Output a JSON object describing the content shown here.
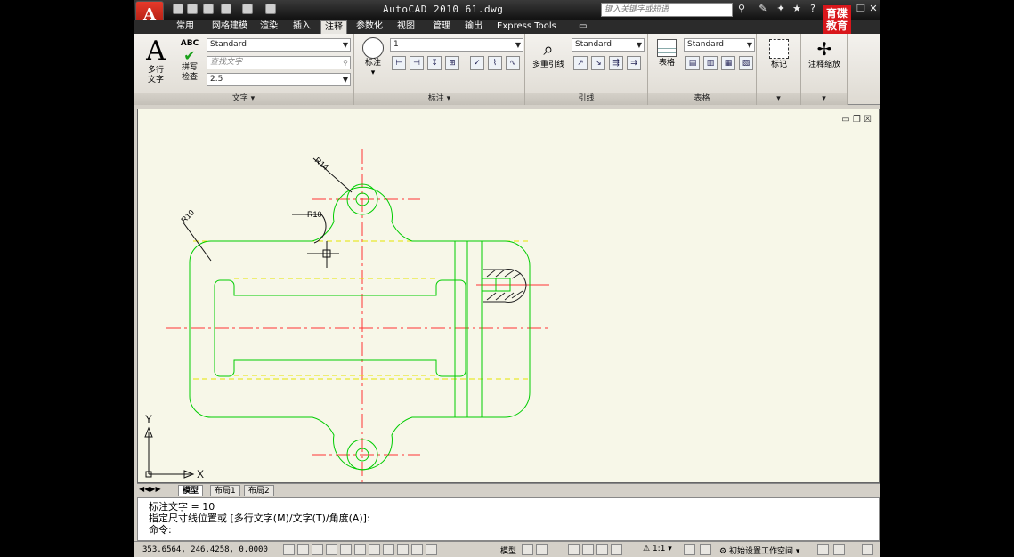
{
  "window": {
    "title": "AutoCAD 2010   61.dwg",
    "search_placeholder": "键入关键字或短语",
    "logo": "A",
    "edu_logo_line1": "育碟",
    "edu_logo_line2": "教育"
  },
  "ribbon_tabs": [
    "常用",
    "网格建模",
    "渲染",
    "插入",
    "注释",
    "参数化",
    "视图",
    "管理",
    "输出",
    "Express Tools"
  ],
  "active_tab": "注释",
  "text_panel": {
    "title": "文字",
    "mtext_label1": "多行",
    "mtext_label2": "文字",
    "spell_label1": "拼写",
    "spell_label2": "检查",
    "abc": "ABC",
    "style_combo": "Standard",
    "find_placeholder": "查找文字",
    "height_combo": "2.5"
  },
  "dim_panel": {
    "title": "标注",
    "dim_label": "标注",
    "style_combo": "1"
  },
  "leader_panel": {
    "title": "引线",
    "multileader_label": "多重引线",
    "style_combo": "Standard"
  },
  "table_panel": {
    "title": "表格",
    "table_label": "表格",
    "style_combo": "Standard"
  },
  "markup_panel": {
    "label": "标记"
  },
  "scale_panel": {
    "label": "注释缩放"
  },
  "drawing": {
    "dims": [
      "R14",
      "R10",
      "R10"
    ],
    "axis_x": "X",
    "axis_y": "Y"
  },
  "layout_tabs": [
    "模型",
    "布局1",
    "布局2"
  ],
  "command": {
    "line1": "标注文字 = 10",
    "line2": "指定尺寸线位置或 [多行文字(M)/文字(T)/角度(A)]:",
    "prompt": "命令:"
  },
  "status": {
    "coords": "353.6564, 246.4258, 0.0000",
    "model": "模型",
    "scale": "1:1",
    "workspace": "初始设置工作空间"
  },
  "colors": {
    "geometry": "#00cc00",
    "centerline": "#ff3333",
    "hidden": "#e6e600",
    "hatch": "#222222"
  }
}
